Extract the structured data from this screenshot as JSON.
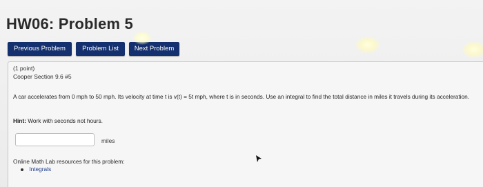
{
  "page": {
    "title": "HW06: Problem 5"
  },
  "nav": {
    "previous_label": "Previous Problem",
    "list_label": "Problem List",
    "next_label": "Next Problem",
    "button_color": "#14306e"
  },
  "problem": {
    "points": "(1 point)",
    "source": "Cooper Section 9.6 #5",
    "text": "A car accelerates from 0 mph to 50 mph. Its velocity at time t is v(t) = 5t mph, where t is in seconds. Use an integral to find the total distance in miles it travels during its acceleration.",
    "hint_label": "Hint:",
    "hint_text": "Work with seconds not hours.",
    "answer": {
      "value": "",
      "units": "miles"
    },
    "resources_label": "Online Math Lab resources for this problem:",
    "resources": [
      "Integrals"
    ]
  }
}
